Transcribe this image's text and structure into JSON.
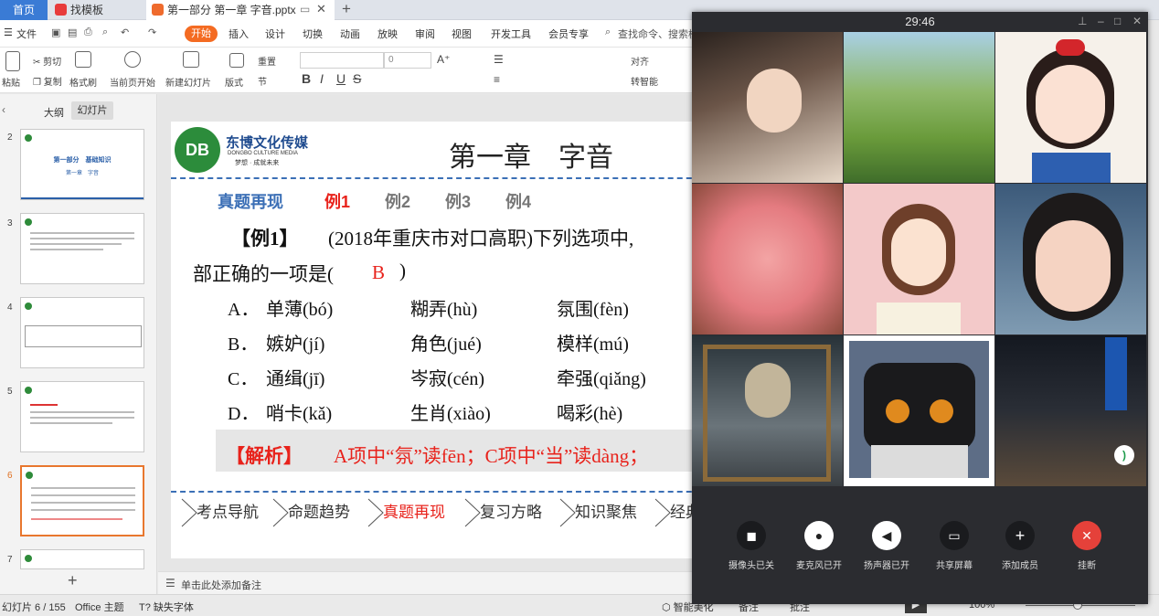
{
  "tabs": {
    "home": "首页",
    "template": "找模板",
    "doc": "第一部分 第一章 字音.pptx"
  },
  "menu": {
    "file": "文件",
    "start": "开始",
    "items": [
      "插入",
      "设计",
      "切换",
      "动画",
      "放映",
      "审阅",
      "视图",
      "开发工具",
      "会员专享"
    ],
    "search": "查找命令、搜索模"
  },
  "toolbar": {
    "paste": "粘贴",
    "cut": "剪切",
    "copy": "复制",
    "format_painter": "格式刷",
    "from_current": "当前页开始",
    "new_slide": "新建幻灯片",
    "layout": "版式",
    "section": "节",
    "reset": "重置",
    "font_size": "0",
    "align": "对齐",
    "convert": "转智能"
  },
  "leftpanel": {
    "tab_outline": "大纲",
    "tab_slides": "幻灯片",
    "slide_numbers": [
      "2",
      "3",
      "4",
      "5",
      "6",
      "7"
    ],
    "thumb2_title": "第一部分　基础知识",
    "thumb2_sub": "第一章　字音"
  },
  "slide": {
    "logo_cn": "东博文化传媒",
    "logo_en": "DONGBO CULTURE MEDIA",
    "logo_slogan": "梦想 · 成就未来",
    "logo_mark": "DB",
    "title": "第一章　字音",
    "tabs": [
      "真题再现",
      "例1",
      "例2",
      "例3",
      "例4"
    ],
    "question_label": "【例1】",
    "question_text": "(2018年重庆市对口高职)下列选项中,",
    "question_line2": "部正确的一项是(",
    "answer": "B",
    "close_paren": ")",
    "options": [
      {
        "label": "A．",
        "c1": "单薄(bó)",
        "c2": "糊弄(hù)",
        "c3": "氛围(fèn)"
      },
      {
        "label": "B．",
        "c1": "嫉妒(jí)",
        "c2": "角色(jué)",
        "c3": "模样(mú)"
      },
      {
        "label": "C．",
        "c1": "通缉(jī)",
        "c2": "岑寂(cén)",
        "c3": "牵强(qiǎng)"
      },
      {
        "label": "D．",
        "c1": "哨卡(kǎ)",
        "c2": "生肖(xiào)",
        "c3": "喝彩(hè)"
      }
    ],
    "analysis_label": "【解析】",
    "analysis_text": "A项中“氛”读fēn；C项中“当”读dàng；",
    "nav": [
      "考点导航",
      "命题趋势",
      "真题再现",
      "复习方略",
      "知识聚焦",
      "经典"
    ]
  },
  "notes": {
    "placeholder": "单击此处添加备注"
  },
  "status": {
    "slide_info": "幻灯片 6 / 155",
    "theme": "Office 主题",
    "missing_font": "缺失字体",
    "beautify": "智能美化",
    "notes": "备注",
    "comments": "批注",
    "zoom": "100%"
  },
  "meeting": {
    "timer": "29:46",
    "controls": [
      "摄像头已关",
      "麦克风已开",
      "扬声器已开",
      "共享屏幕",
      "添加成员",
      "挂断"
    ]
  },
  "colors": {
    "accent": "#f46b22",
    "slide_blue": "#3b6fb6",
    "red": "#e8221b",
    "hangup": "#e5413a"
  }
}
